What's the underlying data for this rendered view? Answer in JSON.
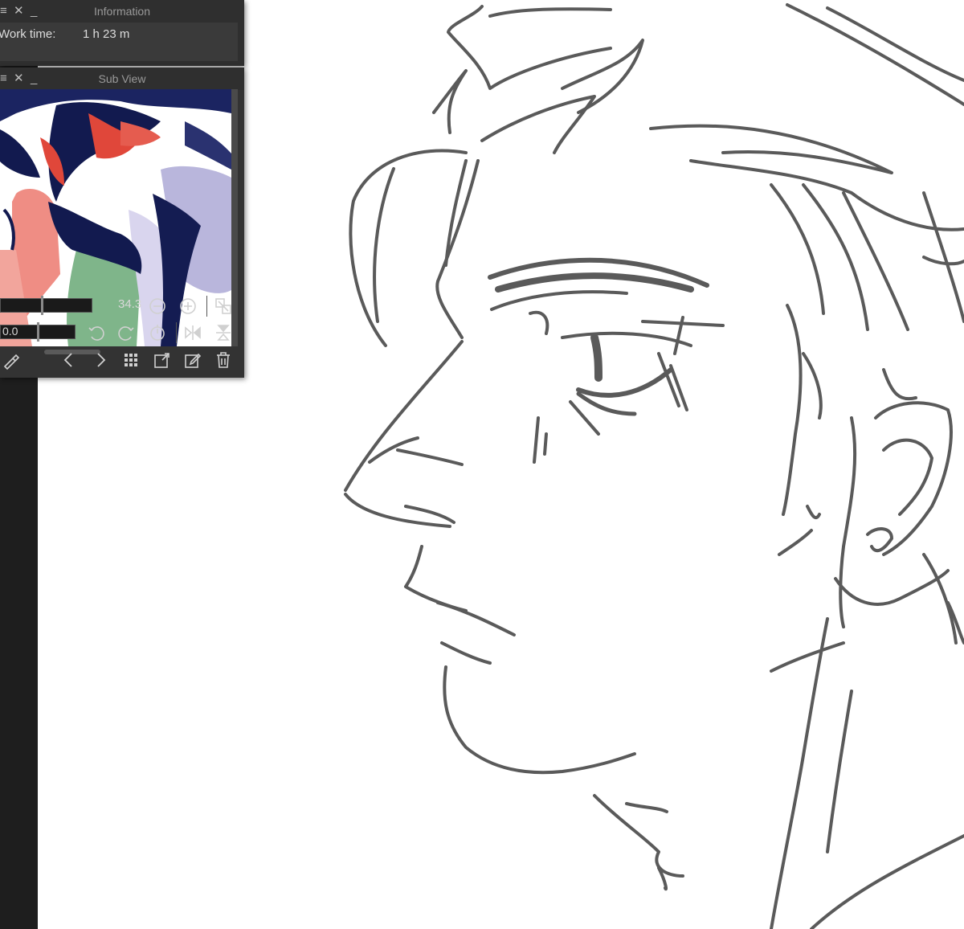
{
  "information_panel": {
    "title": "Information",
    "work_time_label": "Work time:",
    "work_time_value": "1 h 23 m"
  },
  "sub_view_panel": {
    "title": "Sub View",
    "zoom_value": "34.3",
    "rotation_value": "0.0",
    "icons": [
      "menu-icon",
      "close-icon",
      "minimize-icon",
      "zoom-out-icon",
      "zoom-in-icon",
      "fit-view-icon",
      "rotate-left-icon",
      "rotate-right-icon",
      "reset-rotation-icon",
      "flip-horizontal-icon",
      "flip-vertical-icon",
      "eyedropper-icon",
      "previous-icon",
      "next-icon",
      "grid-view-icon",
      "import-image-icon",
      "edit-image-icon",
      "delete-icon"
    ]
  },
  "colors": {
    "panel_background": "#3a3a3a",
    "titlebar_background": "#2f2f2f",
    "sketch_stroke": "#555555",
    "preview_navy": "#121a4f",
    "preview_red": "#e0473a",
    "preview_pink": "#ef8d84",
    "preview_lavender": "#b9b6dc",
    "preview_green": "#7fb58a"
  }
}
